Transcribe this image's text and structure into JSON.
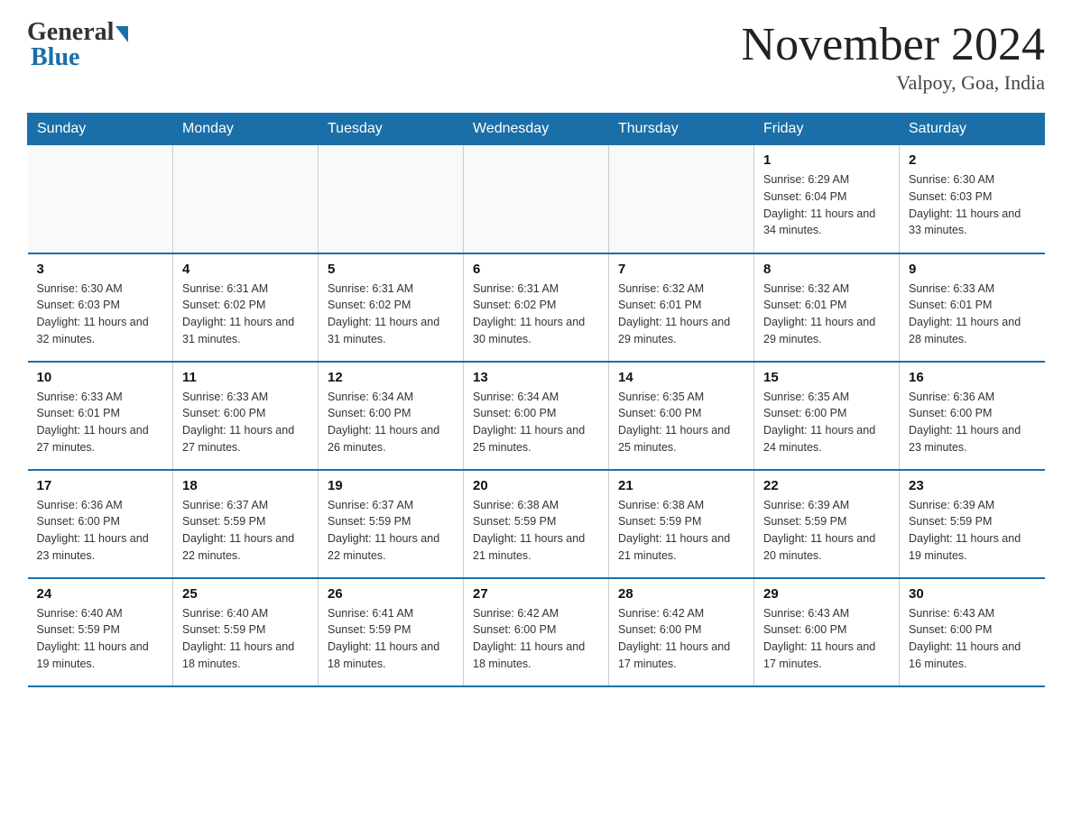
{
  "header": {
    "logo_general": "General",
    "logo_blue": "Blue",
    "title": "November 2024",
    "location": "Valpoy, Goa, India"
  },
  "days_of_week": [
    "Sunday",
    "Monday",
    "Tuesday",
    "Wednesday",
    "Thursday",
    "Friday",
    "Saturday"
  ],
  "weeks": [
    [
      {
        "day": "",
        "info": ""
      },
      {
        "day": "",
        "info": ""
      },
      {
        "day": "",
        "info": ""
      },
      {
        "day": "",
        "info": ""
      },
      {
        "day": "",
        "info": ""
      },
      {
        "day": "1",
        "info": "Sunrise: 6:29 AM\nSunset: 6:04 PM\nDaylight: 11 hours and 34 minutes."
      },
      {
        "day": "2",
        "info": "Sunrise: 6:30 AM\nSunset: 6:03 PM\nDaylight: 11 hours and 33 minutes."
      }
    ],
    [
      {
        "day": "3",
        "info": "Sunrise: 6:30 AM\nSunset: 6:03 PM\nDaylight: 11 hours and 32 minutes."
      },
      {
        "day": "4",
        "info": "Sunrise: 6:31 AM\nSunset: 6:02 PM\nDaylight: 11 hours and 31 minutes."
      },
      {
        "day": "5",
        "info": "Sunrise: 6:31 AM\nSunset: 6:02 PM\nDaylight: 11 hours and 31 minutes."
      },
      {
        "day": "6",
        "info": "Sunrise: 6:31 AM\nSunset: 6:02 PM\nDaylight: 11 hours and 30 minutes."
      },
      {
        "day": "7",
        "info": "Sunrise: 6:32 AM\nSunset: 6:01 PM\nDaylight: 11 hours and 29 minutes."
      },
      {
        "day": "8",
        "info": "Sunrise: 6:32 AM\nSunset: 6:01 PM\nDaylight: 11 hours and 29 minutes."
      },
      {
        "day": "9",
        "info": "Sunrise: 6:33 AM\nSunset: 6:01 PM\nDaylight: 11 hours and 28 minutes."
      }
    ],
    [
      {
        "day": "10",
        "info": "Sunrise: 6:33 AM\nSunset: 6:01 PM\nDaylight: 11 hours and 27 minutes."
      },
      {
        "day": "11",
        "info": "Sunrise: 6:33 AM\nSunset: 6:00 PM\nDaylight: 11 hours and 27 minutes."
      },
      {
        "day": "12",
        "info": "Sunrise: 6:34 AM\nSunset: 6:00 PM\nDaylight: 11 hours and 26 minutes."
      },
      {
        "day": "13",
        "info": "Sunrise: 6:34 AM\nSunset: 6:00 PM\nDaylight: 11 hours and 25 minutes."
      },
      {
        "day": "14",
        "info": "Sunrise: 6:35 AM\nSunset: 6:00 PM\nDaylight: 11 hours and 25 minutes."
      },
      {
        "day": "15",
        "info": "Sunrise: 6:35 AM\nSunset: 6:00 PM\nDaylight: 11 hours and 24 minutes."
      },
      {
        "day": "16",
        "info": "Sunrise: 6:36 AM\nSunset: 6:00 PM\nDaylight: 11 hours and 23 minutes."
      }
    ],
    [
      {
        "day": "17",
        "info": "Sunrise: 6:36 AM\nSunset: 6:00 PM\nDaylight: 11 hours and 23 minutes."
      },
      {
        "day": "18",
        "info": "Sunrise: 6:37 AM\nSunset: 5:59 PM\nDaylight: 11 hours and 22 minutes."
      },
      {
        "day": "19",
        "info": "Sunrise: 6:37 AM\nSunset: 5:59 PM\nDaylight: 11 hours and 22 minutes."
      },
      {
        "day": "20",
        "info": "Sunrise: 6:38 AM\nSunset: 5:59 PM\nDaylight: 11 hours and 21 minutes."
      },
      {
        "day": "21",
        "info": "Sunrise: 6:38 AM\nSunset: 5:59 PM\nDaylight: 11 hours and 21 minutes."
      },
      {
        "day": "22",
        "info": "Sunrise: 6:39 AM\nSunset: 5:59 PM\nDaylight: 11 hours and 20 minutes."
      },
      {
        "day": "23",
        "info": "Sunrise: 6:39 AM\nSunset: 5:59 PM\nDaylight: 11 hours and 19 minutes."
      }
    ],
    [
      {
        "day": "24",
        "info": "Sunrise: 6:40 AM\nSunset: 5:59 PM\nDaylight: 11 hours and 19 minutes."
      },
      {
        "day": "25",
        "info": "Sunrise: 6:40 AM\nSunset: 5:59 PM\nDaylight: 11 hours and 18 minutes."
      },
      {
        "day": "26",
        "info": "Sunrise: 6:41 AM\nSunset: 5:59 PM\nDaylight: 11 hours and 18 minutes."
      },
      {
        "day": "27",
        "info": "Sunrise: 6:42 AM\nSunset: 6:00 PM\nDaylight: 11 hours and 18 minutes."
      },
      {
        "day": "28",
        "info": "Sunrise: 6:42 AM\nSunset: 6:00 PM\nDaylight: 11 hours and 17 minutes."
      },
      {
        "day": "29",
        "info": "Sunrise: 6:43 AM\nSunset: 6:00 PM\nDaylight: 11 hours and 17 minutes."
      },
      {
        "day": "30",
        "info": "Sunrise: 6:43 AM\nSunset: 6:00 PM\nDaylight: 11 hours and 16 minutes."
      }
    ]
  ]
}
